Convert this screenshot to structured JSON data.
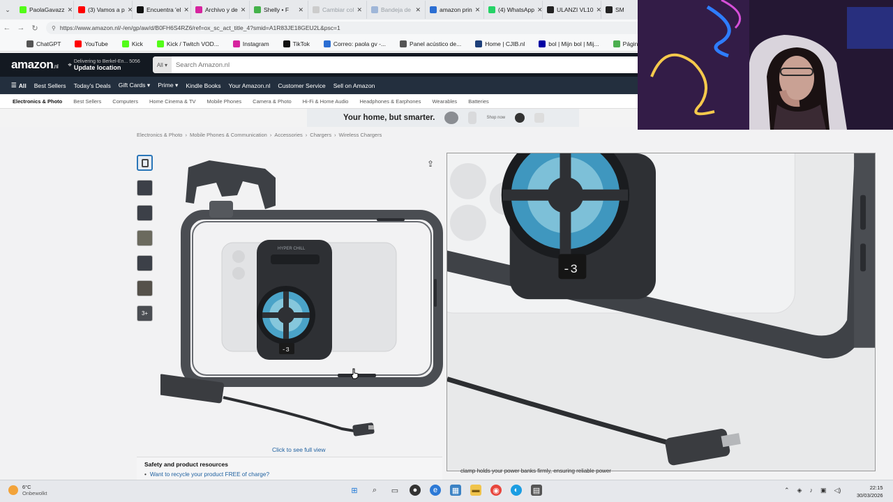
{
  "tabs": [
    {
      "label": "PaolaGavazz",
      "color": "#53fc18",
      "dim": false
    },
    {
      "label": "(3) Vamos a p",
      "color": "#ff0000",
      "dim": false
    },
    {
      "label": "Encuentra 'el",
      "color": "#111111",
      "dim": false
    },
    {
      "label": "Archivo y de",
      "color": "#d6249f",
      "dim": false
    },
    {
      "label": "Shelly • F",
      "color": "#44b24a",
      "dim": false
    },
    {
      "label": "Cambiar col",
      "color": "#cccccc",
      "dim": true
    },
    {
      "label": "Bandeja de",
      "color": "#9fb6d8",
      "dim": true
    },
    {
      "label": "amazon prin",
      "color": "#2b6ed3",
      "dim": false
    },
    {
      "label": "(4) WhatsApp",
      "color": "#25d366",
      "dim": false
    },
    {
      "label": "ULANZI VL10",
      "color": "#222222",
      "dim": false
    },
    {
      "label": "SM",
      "color": "#222222",
      "dim": false
    }
  ],
  "address": {
    "url": "https://www.amazon.nl/-/en/gp/aw/d/B0FH6S4RZ6/ref=ox_sc_act_title_4?smid=A1R83JE18GEU2L&psc=1"
  },
  "bookmarks": [
    {
      "label": "ChatGPT",
      "color": "#555555"
    },
    {
      "label": "YouTube",
      "color": "#ff0000"
    },
    {
      "label": "Kick",
      "color": "#53fc18"
    },
    {
      "label": "Kick / Twitch VOD...",
      "color": "#53fc18"
    },
    {
      "label": "Instagram",
      "color": "#d6249f"
    },
    {
      "label": "TikTok",
      "color": "#111111"
    },
    {
      "label": "Correo: paola gv -...",
      "color": "#2b6ed3"
    },
    {
      "label": "Panel acústico de...",
      "color": "#555555"
    },
    {
      "label": "Home | CJIB.nl",
      "color": "#1d3f7a"
    },
    {
      "label": "bol | Mijn bol | Mij...",
      "color": "#0000a4"
    },
    {
      "label": "Página principal -...",
      "color": "#4caf50"
    }
  ],
  "header": {
    "logo": "amazon",
    "logo_tld": ".nl",
    "deliver_line1": "Delivering to Berkel-En... 5056",
    "deliver_line2": "Update location",
    "search_scope": "All",
    "search_placeholder": "Search Amazon.nl"
  },
  "nav": {
    "all": "All",
    "items": [
      "Best Sellers",
      "Today's Deals",
      "Gift Cards",
      "Prime",
      "Kindle Books",
      "Your Amazon.nl",
      "Customer Service",
      "Sell on Amazon"
    ]
  },
  "subnav": [
    "Electronics & Photo",
    "Best Sellers",
    "Computers",
    "Home Cinema & TV",
    "Mobile Phones",
    "Camera & Photo",
    "Hi-Fi & Home Audio",
    "Headphones & Earphones",
    "Wearables",
    "Batteries"
  ],
  "banner": {
    "text": "Your home, but smarter.",
    "shop": "Shop now"
  },
  "breadcrumbs": [
    "Electronics & Photo",
    "Mobile Phones & Communication",
    "Accessories",
    "Chargers",
    "Wireless Chargers"
  ],
  "thumbs_more": "3+",
  "product": {
    "fan_brand": "HYPER CHILL",
    "readout": "-3",
    "full_view": "Click to see full view"
  },
  "safety": {
    "heading": "Safety and product resources",
    "link": "Want to recycle your product FREE of charge?"
  },
  "behind_text": "clamp holds your power banks firmly, ensuring reliable power",
  "taskbar": {
    "temp": "6°C",
    "condition": "Onbewolkt",
    "time": "22:15",
    "date": "30/03/2026"
  }
}
